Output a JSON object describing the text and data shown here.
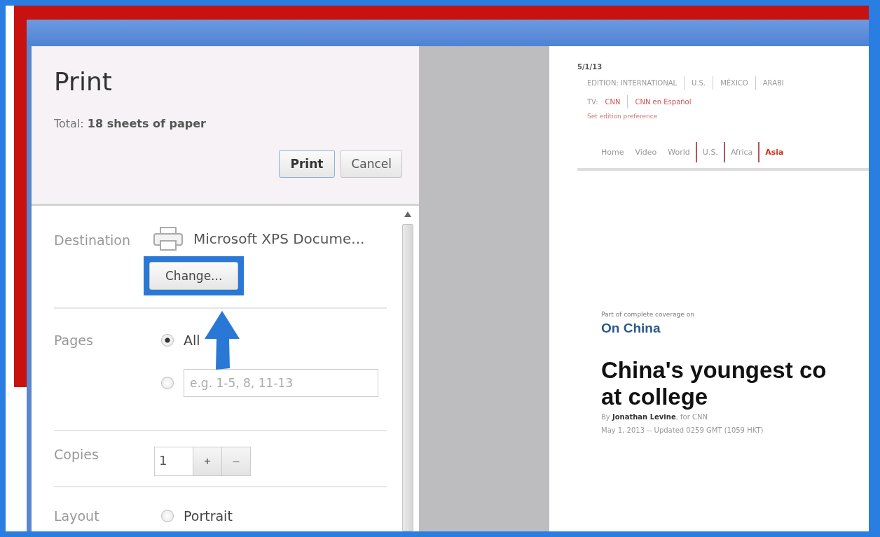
{
  "dialog": {
    "title": "Print",
    "total": "Total: **18 sheets of paper**",
    "buttons": [
      {
        "label": "Print",
        "kind": "primary"
      },
      {
        "label": "Cancel",
        "kind": "secondary"
      }
    ]
  },
  "destination": {
    "label": "Destination",
    "value": "Microsoft XPS Docume...",
    "button": "Change...",
    "highlighted": true
  },
  "pages": {
    "label": "Pages",
    "options": [
      {
        "kind": "all",
        "label": "All",
        "selected": true
      },
      {
        "kind": "range",
        "placeholder": "e.g. 1-5, 8, 11-13",
        "selected": false
      }
    ]
  },
  "copies": {
    "label": "Copies",
    "value": "1",
    "increment": "+",
    "decrement": "–",
    "decrement_disabled": true
  },
  "layout": {
    "label": "Layout",
    "options": [
      {
        "label": "Portrait",
        "selected": false
      }
    ]
  },
  "preview": {
    "date": "5/1/13",
    "edition_links": [
      "EDITION: INTERNATIONAL",
      "U.S.",
      "MÉXICO",
      "ARABI"
    ],
    "tv_label": "TV:",
    "tv_links": [
      "CNN",
      "CNN en Español"
    ],
    "edition_preference": "Set edition preference",
    "nav": [
      {
        "label": "Home",
        "selected": false
      },
      {
        "label": "Video",
        "selected": false
      },
      {
        "label": "World",
        "selected": false
      },
      {
        "label": "U.S.",
        "selected": false
      },
      {
        "label": "Africa",
        "selected": false
      },
      {
        "label": "Asia",
        "selected": true
      }
    ],
    "kicker": "Part of complete coverage on",
    "section": "On China",
    "headline": [
      "China's youngest co",
      "at college"
    ],
    "byline": "By **Jonathan Levine**, for CNN",
    "dateline": "May 1, 2013 -- Updated 0259 GMT (1059 HKT)"
  }
}
